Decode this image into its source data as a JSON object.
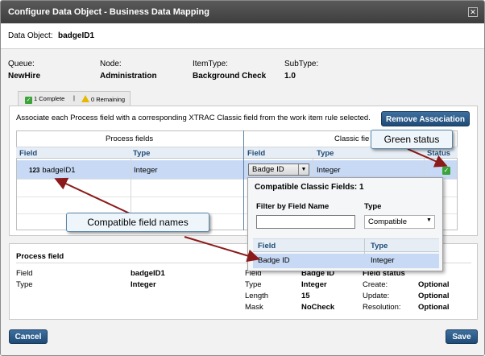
{
  "dialog": {
    "title": "Configure Data Object - Business Data Mapping",
    "close_icon": "close-icon"
  },
  "data_object": {
    "label": "Data Object:",
    "value": "badgeID1"
  },
  "meta": [
    {
      "label": "Queue:",
      "value": "NewHire"
    },
    {
      "label": "Node:",
      "value": "Administration"
    },
    {
      "label": "ItemType:",
      "value": "Background Check"
    },
    {
      "label": "SubType:",
      "value": "1.0"
    }
  ],
  "tabs": {
    "complete": "1 Complete",
    "separator": "|",
    "remaining": "0 Remaining"
  },
  "instruction": "Associate each Process field with a corresponding XTRAC Classic field from the work item rule selected.",
  "remove_button": "Remove Association",
  "grid": {
    "process_header": "Process fields",
    "classic_header": "Classic fie",
    "columns": {
      "field": "Field",
      "type": "Type",
      "field2": "Field",
      "type2": "Type",
      "status": "Status"
    },
    "row": {
      "number_icon": "123",
      "field": "badgeID1",
      "type": "Integer",
      "classic_field": "Badge ID",
      "classic_type": "Integer"
    }
  },
  "popup": {
    "title": "Compatible Classic Fields: 1",
    "filter_label": "Filter by Field Name",
    "filter_value": "",
    "type_label": "Type",
    "type_value": "Compatible",
    "col_field": "Field",
    "col_type": "Type",
    "row_field": "Badge ID",
    "row_type": "Integer"
  },
  "bottom": {
    "title": "Process field",
    "left": [
      {
        "label": "Field",
        "value": "badgeID1"
      },
      {
        "label": "Type",
        "value": "Integer"
      }
    ],
    "mid": [
      {
        "label": "Field",
        "value": "Badge ID"
      },
      {
        "label": "Type",
        "value": "Integer"
      },
      {
        "label": "Length",
        "value": "15"
      },
      {
        "label": "Mask",
        "value": "NoCheck"
      }
    ],
    "status_header": "Field status",
    "right": [
      {
        "label": "Create:",
        "value": "Optional"
      },
      {
        "label": "Update:",
        "value": "Optional"
      },
      {
        "label": "Resolution:",
        "value": "Optional"
      }
    ]
  },
  "callouts": {
    "green": "Green status",
    "compatible": "Compatible field names"
  },
  "buttons": {
    "cancel": "Cancel",
    "save": "Save"
  },
  "colors": {
    "accent": "#1f4b77",
    "selection": "#c7d9f4",
    "status_ok": "#3aa33a"
  }
}
